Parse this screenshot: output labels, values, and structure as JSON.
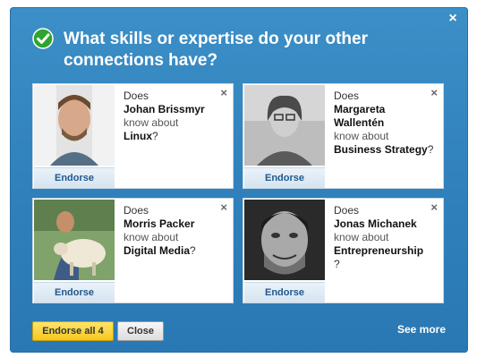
{
  "dialog": {
    "title": "What skills or expertise do your other connections have?",
    "close_symbol": "×"
  },
  "cards": [
    {
      "does": "Does",
      "name": "Johan Brissmyr",
      "know": "know about",
      "skill": "Linux",
      "q": "?",
      "endorse": "Endorse",
      "close": "×"
    },
    {
      "does": "Does",
      "name": "Margareta Wallentén",
      "know": "know about",
      "skill": "Business Strategy",
      "q": "?",
      "endorse": "Endorse",
      "close": "×"
    },
    {
      "does": "Does",
      "name": "Morris Packer",
      "know": "know about",
      "skill": "Digital Media",
      "q": "?",
      "endorse": "Endorse",
      "close": "×"
    },
    {
      "does": "Does",
      "name": "Jonas Michanek",
      "know": "know about",
      "skill": "Entrepreneurship",
      "q": "?",
      "endorse": "Endorse",
      "close": "×"
    }
  ],
  "footer": {
    "endorse_all": "Endorse all 4",
    "close": "Close",
    "see_more": "See more"
  },
  "colors": {
    "dialog_bg": "#3c8fc7",
    "accent_yellow": "#f6c81e",
    "check_green": "#2fa52f"
  }
}
